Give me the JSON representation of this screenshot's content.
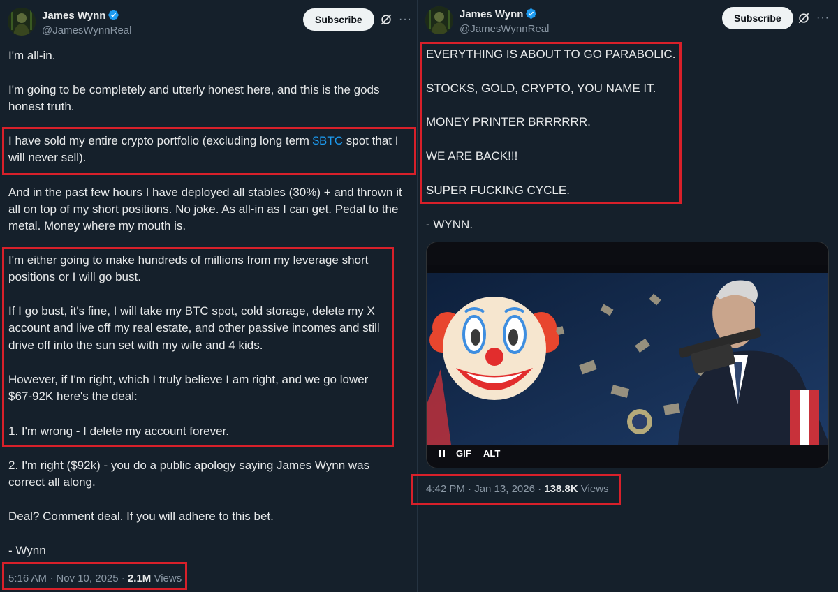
{
  "left_tweet": {
    "author_name": "James Wynn",
    "handle": "@JamesWynnReal",
    "subscribe_label": "Subscribe",
    "more_label": "···",
    "lines": {
      "l1": "I'm all-in.",
      "l2": "I'm going to be completely and utterly honest here, and this is the gods",
      "l3": "honest truth.",
      "l4a": "I have sold my entire crypto portfolio (excluding long term ",
      "l4b": "$BTC",
      "l4c": " spot that I",
      "l5": "will never sell).",
      "l6": "And in the past few hours I have deployed all stables (30%) + and thrown it",
      "l7": "all on top of my short positions. No joke. As all-in as I can get. Pedal to the",
      "l8": "metal. Money where my mouth is.",
      "l9": "I'm either going to make hundreds of millions from my leverage short",
      "l10": "positions or I will go bust.",
      "l11": "If I go bust, it's fine, I will take my BTC spot, cold storage, delete my X",
      "l12": "account and live off my real estate, and other passive incomes and still",
      "l13": "drive off into the sun set with my wife and 4 kids.",
      "l14": "However, if I'm right, which I truly believe I am right, and we go lower",
      "l15": "$67-92K here's the deal:",
      "l16": "1. I'm wrong - I delete my account forever.",
      "l17": "2. I'm right ($92k) - you do a public apology saying James Wynn was",
      "l18": "correct all along.",
      "l19": "Deal? Comment deal. If you will adhere to this bet.",
      "l20": "- Wynn"
    },
    "time": "5:16 AM · Nov 10, 2025 · ",
    "views_count": "2.1M",
    "views_label": " Views"
  },
  "right_tweet": {
    "author_name": "James Wynn",
    "handle": "@JamesWynnReal",
    "subscribe_label": "Subscribe",
    "more_label": "···",
    "lines": {
      "r1": "EVERYTHING IS ABOUT TO GO PARABOLIC.",
      "r2": "STOCKS, GOLD, CRYPTO, YOU NAME IT.",
      "r3": "MONEY PRINTER BRRRRRR.",
      "r4": "WE ARE BACK!!!",
      "r5": "SUPER FUCKING CYCLE.",
      "r6": "- WYNN."
    },
    "media": {
      "pause_icon": "pause-icon",
      "gif_label": "GIF",
      "alt_label": "ALT"
    },
    "time": "4:42 PM · Jan 13, 2026 · ",
    "views_count": "138.8K",
    "views_label": " Views"
  },
  "colors": {
    "background": "#15202b",
    "text": "#e7e9ea",
    "secondary": "#8b98a5",
    "link": "#1d9bf0",
    "highlight_box": "#d8202a",
    "verified": "#1d9bf0"
  }
}
